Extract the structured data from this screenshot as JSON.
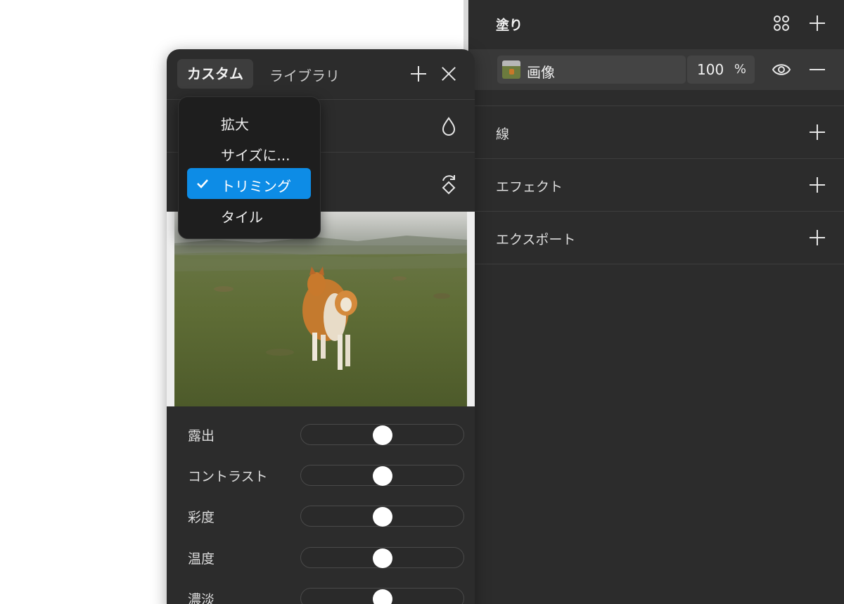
{
  "properties": {
    "fill": {
      "title": "塗り",
      "layer_name": "画像",
      "opacity_value": "100",
      "opacity_unit": "%"
    },
    "stroke": {
      "title": "線"
    },
    "effect": {
      "title": "エフェクト"
    },
    "export": {
      "title": "エクスポート"
    }
  },
  "popup": {
    "tab_custom": "カスタム",
    "tab_library": "ライブラリ",
    "adjustments": [
      {
        "label": "露出",
        "value": 0.5
      },
      {
        "label": "コントラスト",
        "value": 0.5
      },
      {
        "label": "彩度",
        "value": 0.5
      },
      {
        "label": "温度",
        "value": 0.5
      },
      {
        "label": "濃淡",
        "value": 0.5
      }
    ]
  },
  "scale_menu": {
    "items": [
      {
        "label": "拡大",
        "selected": false
      },
      {
        "label": "サイズに...",
        "selected": false
      },
      {
        "label": "トリミング",
        "selected": true
      },
      {
        "label": "タイル",
        "selected": false
      }
    ]
  },
  "colors": {
    "accent": "#0d8ce6",
    "panel": "#2c2c2c",
    "menu": "#1e1e1e"
  }
}
